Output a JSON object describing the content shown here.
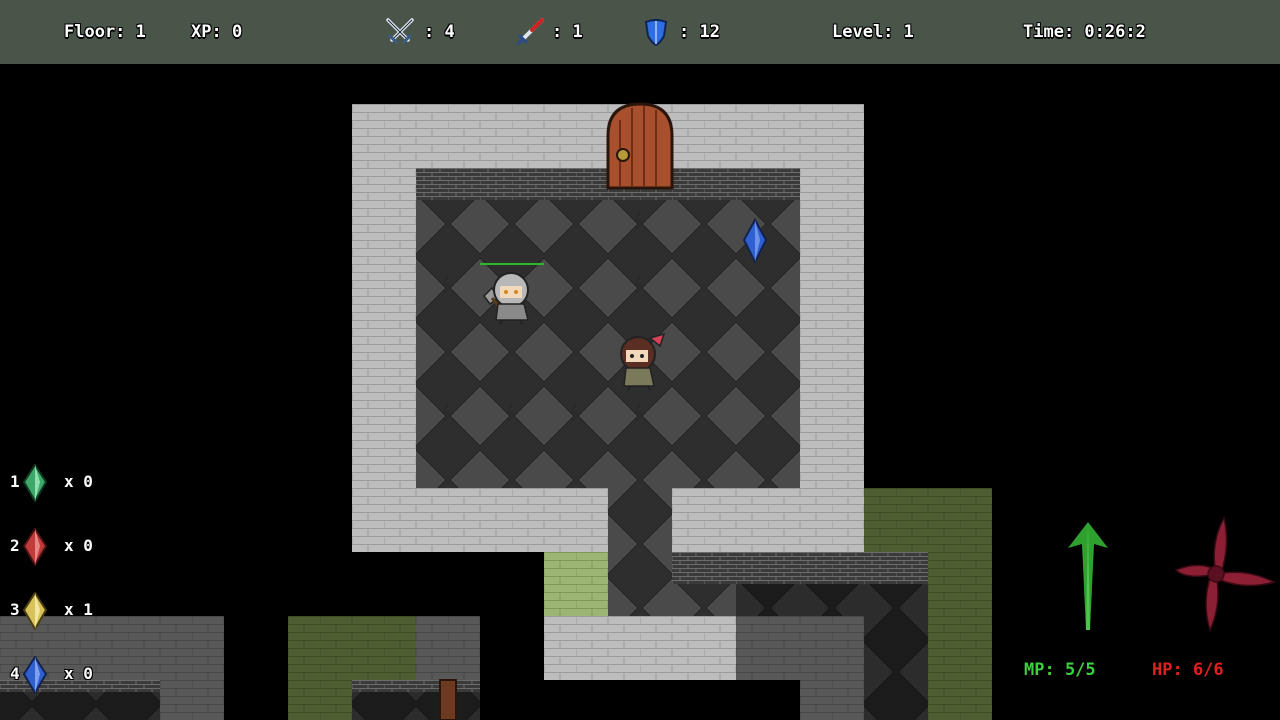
{
  "hud": {
    "floor": "Floor: 1",
    "xp": "XP: 0",
    "attack": ": 4",
    "magic": ": 1",
    "defense": ": 12",
    "level": "Level: 1",
    "time": "Time: 0:26:2"
  },
  "inventory": [
    {
      "slot": "1",
      "count": "x 0",
      "color": "#3ea86a",
      "name": "green-crystal"
    },
    {
      "slot": "2",
      "count": "x 0",
      "color": "#c23b3b",
      "name": "red-crystal"
    },
    {
      "slot": "3",
      "count": "x 1",
      "color": "#d8c25a",
      "name": "yellow-crystal"
    },
    {
      "slot": "4",
      "count": "x 0",
      "color": "#2f5fd0",
      "name": "blue-crystal"
    }
  ],
  "status": {
    "mp": "MP: 5/5",
    "hp": "HP: 6/6",
    "mp_color": "#3ecf3e",
    "hp_color": "#e02020"
  },
  "spells": {
    "left_icon": "green-arrow-up-icon",
    "right_icon": "red-shuriken-icon",
    "left_color": "#2fa12f",
    "right_color": "#8c1f33"
  }
}
